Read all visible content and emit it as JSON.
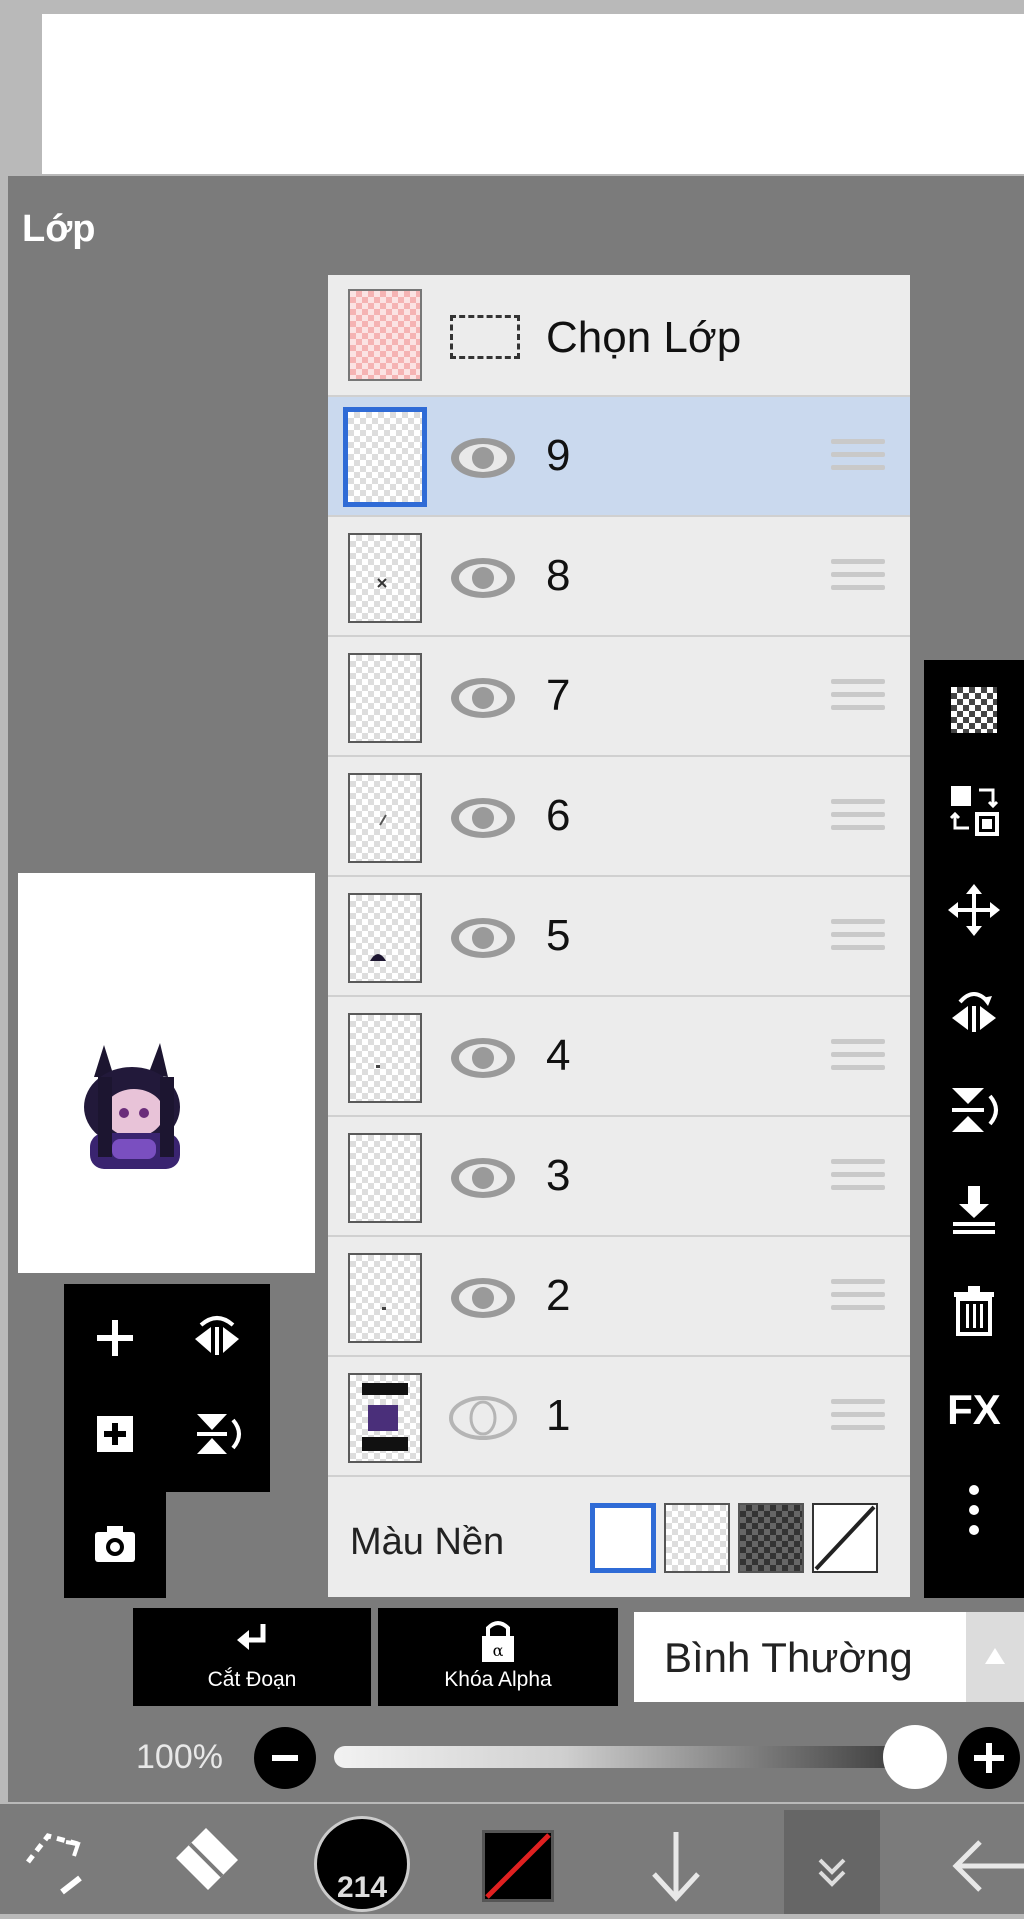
{
  "panel": {
    "title": "Lớp"
  },
  "layers_header": {
    "select_label": "Chọn Lớp"
  },
  "layers": [
    {
      "name": "9",
      "selected": true,
      "visible": true
    },
    {
      "name": "8",
      "selected": false,
      "visible": true
    },
    {
      "name": "7",
      "selected": false,
      "visible": true
    },
    {
      "name": "6",
      "selected": false,
      "visible": true
    },
    {
      "name": "5",
      "selected": false,
      "visible": true
    },
    {
      "name": "4",
      "selected": false,
      "visible": true
    },
    {
      "name": "3",
      "selected": false,
      "visible": true
    },
    {
      "name": "2",
      "selected": false,
      "visible": true
    },
    {
      "name": "1",
      "selected": false,
      "visible": false
    }
  ],
  "background": {
    "label": "Màu Nền",
    "options": [
      "white",
      "transparent",
      "dark-checker",
      "none"
    ],
    "selected": "white"
  },
  "actions": {
    "clipping_label": "Cắt Đoạn",
    "alpha_lock_label": "Khóa Alpha"
  },
  "blend_mode": {
    "value": "Bình Thường"
  },
  "opacity": {
    "label": "100%",
    "value": 100
  },
  "brush": {
    "size": "214"
  },
  "right_toolbar": [
    "checker-icon",
    "copy-layer-icon",
    "move-icon",
    "flip-horizontal-icon",
    "flip-vertical-icon",
    "merge-down-icon",
    "trash-icon",
    "fx-icon",
    "more-icon"
  ],
  "right_toolbar_fx": "FX",
  "colors": {
    "panel": "#7b7b7b",
    "list": "#ececec",
    "selected": "#cad9ee",
    "accent": "#2f6bd6"
  }
}
